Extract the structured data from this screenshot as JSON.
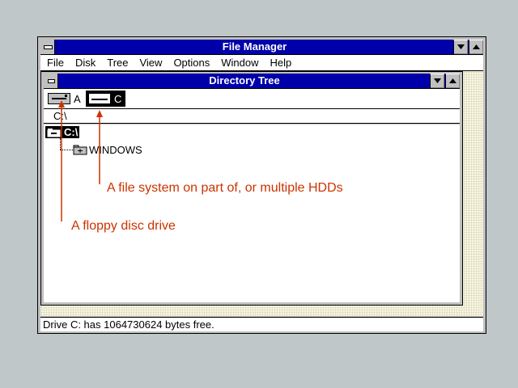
{
  "window": {
    "title": "File Manager",
    "menu": [
      "File",
      "Disk",
      "Tree",
      "View",
      "Options",
      "Window",
      "Help"
    ]
  },
  "child": {
    "title": "Directory Tree",
    "drives": [
      {
        "letter": "A",
        "icon": "floppy-drive-icon",
        "selected": false
      },
      {
        "letter": "C",
        "icon": "hard-drive-icon",
        "selected": true
      }
    ],
    "path": "C:\\",
    "tree": {
      "root": "C:\\",
      "children": [
        "WINDOWS"
      ]
    }
  },
  "status": {
    "text": "Drive C: has 1064730624 bytes free."
  },
  "annotations": {
    "hdd": "A file system on part of, or multiple HDDs",
    "floppy": "A floppy disc drive"
  },
  "colors": {
    "titlebar": "#0000aa",
    "annotation": "#cc3300",
    "desktop": "#c0c7c8"
  }
}
